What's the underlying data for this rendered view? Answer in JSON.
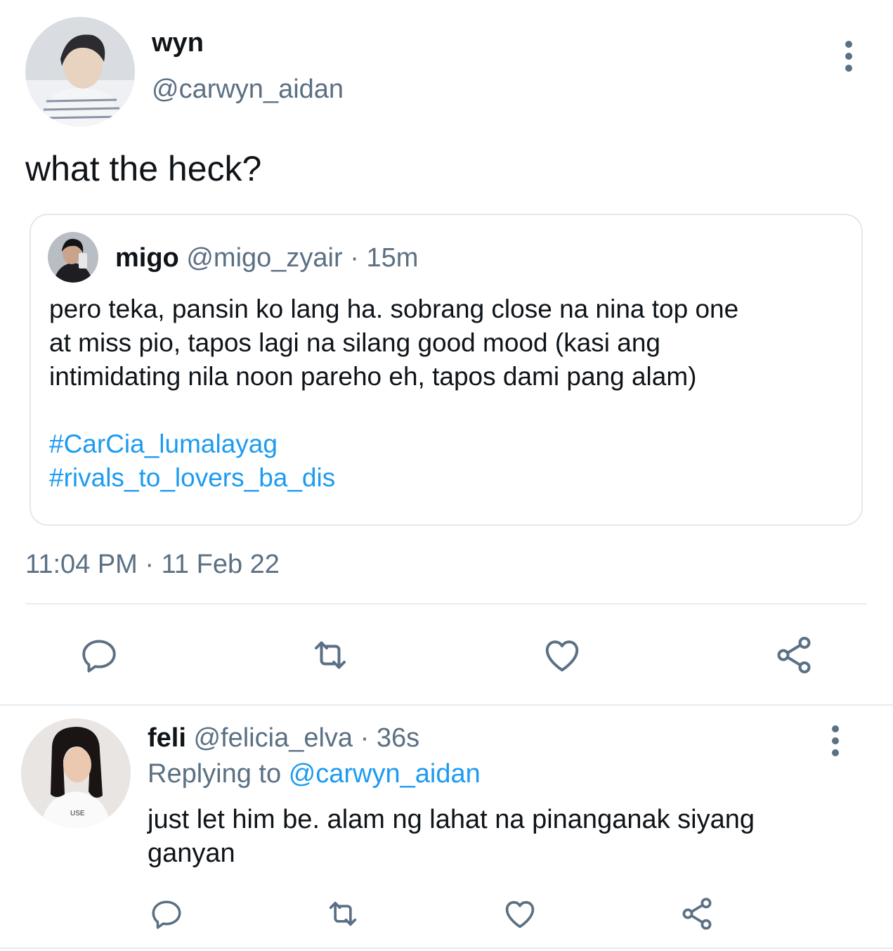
{
  "main_tweet": {
    "display_name": "wyn",
    "handle": "@carwyn_aidan",
    "text": "what the heck?",
    "quoted": {
      "display_name": "migo",
      "handle": "@migo_zyair",
      "separator": "·",
      "time": "15m",
      "text_lines": [
        "pero teka, pansin ko lang ha. sobrang close na nina top one",
        "at miss pio, tapos lagi na silang good mood (kasi ang",
        "intimidating nila noon pareho eh, tapos dami pang alam)"
      ],
      "hashtags": [
        "#CarCia_lumalayag",
        "#rivals_to_lovers_ba_dis"
      ]
    },
    "timestamp": "11:04 PM · 11 Feb 22",
    "actions": [
      "reply-icon",
      "retweet-icon",
      "like-icon",
      "share-icon"
    ]
  },
  "reply": {
    "display_name": "feli",
    "handle": "@felicia_elva",
    "separator": "·",
    "time": "36s",
    "replying_prefix": "Replying to",
    "replying_handle": "@carwyn_aidan",
    "text_lines": [
      "just let him be. alam ng lahat na pinanganak siyang",
      "ganyan"
    ],
    "actions": [
      "reply-icon",
      "retweet-icon",
      "like-icon",
      "share-icon"
    ]
  },
  "colors": {
    "text": "#0f1419",
    "muted": "#5b7083",
    "link": "#1d9bf0",
    "divider": "#e6ecf0"
  }
}
